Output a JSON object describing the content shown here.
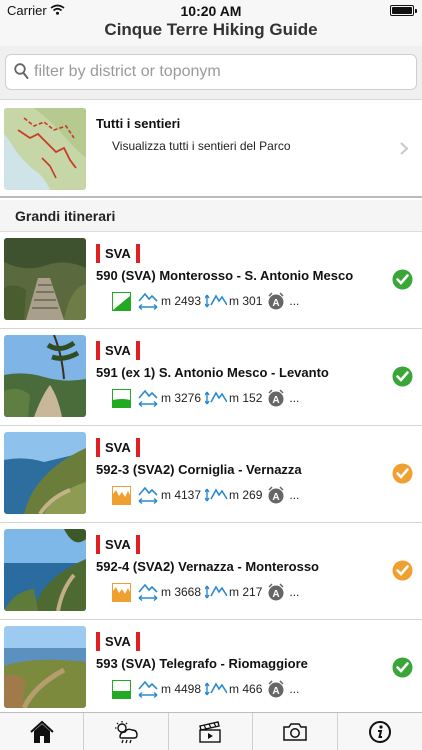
{
  "status_bar": {
    "carrier": "Carrier",
    "time": "10:20 AM"
  },
  "app": {
    "title": "Cinque Terre Hiking Guide"
  },
  "search": {
    "placeholder": "filter by district or toponym"
  },
  "all_trails": {
    "title": "Tutti i sentieri",
    "subtitle": "Visualizza tutti i sentieri del Parco",
    "chevron_icon": "chevron-right-icon"
  },
  "section": {
    "title": "Grandi itinerari"
  },
  "trails": [
    {
      "badge": "SVA",
      "name": "590 (SVA) Monterosso - S. Antonio Mesco",
      "difficulty": "medium-slope",
      "difficulty_color": "#22aa22",
      "distance": "m 2493",
      "elevation": "m 301",
      "more": "...",
      "status": "completed",
      "status_color": "#3aa63a"
    },
    {
      "badge": "SVA",
      "name": "591 (ex 1) S. Antonio Mesco - Levanto",
      "difficulty": "gentle-slope",
      "difficulty_color": "#22aa22",
      "distance": "m 3276",
      "elevation": "m 152",
      "more": "...",
      "status": "completed",
      "status_color": "#3aa63a"
    },
    {
      "badge": "SVA",
      "name": "592-3 (SVA2) Corniglia - Vernazza",
      "difficulty": "hilly",
      "difficulty_color": "#f0a030",
      "distance": "m 4137",
      "elevation": "m 269",
      "more": "...",
      "status": "partial",
      "status_color": "#f0a030"
    },
    {
      "badge": "SVA",
      "name": "592-4 (SVA2) Vernazza - Monterosso",
      "difficulty": "hilly",
      "difficulty_color": "#f0a030",
      "distance": "m 3668",
      "elevation": "m 217",
      "more": "...",
      "status": "partial",
      "status_color": "#f0a030"
    },
    {
      "badge": "SVA",
      "name": "593 (SVA) Telegrafo - Riomaggiore",
      "difficulty": "flat",
      "difficulty_color": "#22aa22",
      "distance": "m 4498",
      "elevation": "m 466",
      "more": "...",
      "status": "completed",
      "status_color": "#3aa63a"
    }
  ],
  "tabbar": {
    "tabs": [
      {
        "icon": "home-icon"
      },
      {
        "icon": "weather-icon"
      },
      {
        "icon": "video-icon"
      },
      {
        "icon": "camera-icon"
      },
      {
        "icon": "info-icon"
      }
    ]
  },
  "colors": {
    "badge_red": "#e02020",
    "chip_blue": "#2a8ad0"
  }
}
